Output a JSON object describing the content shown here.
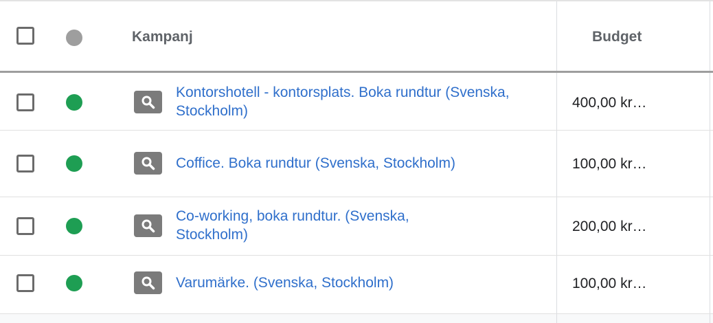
{
  "table": {
    "headers": {
      "campaign": "Kampanj",
      "budget": "Budget"
    },
    "rows": [
      {
        "status": "green",
        "type_icon": "search-icon",
        "campaign": "Kontorshotell - kontorsplats. Boka rundtur (Svenska, Stockholm)",
        "budget": "400,00 kr…"
      },
      {
        "status": "green",
        "type_icon": "search-icon",
        "campaign": "Coffice. Boka rundtur (Svenska, Stockholm)",
        "budget": "100,00 kr…"
      },
      {
        "status": "green",
        "type_icon": "search-icon",
        "campaign": "Co-working, boka rundtur. (Svenska, Stockholm)",
        "budget": "200,00 kr…"
      },
      {
        "status": "green",
        "type_icon": "search-icon",
        "campaign": "Varumärke. (Svenska, Stockholm)",
        "budget": "100,00 kr…"
      }
    ]
  },
  "colors": {
    "status_enabled": "#1e9e53",
    "status_header": "#9e9e9e",
    "link": "#2f6fcb"
  }
}
